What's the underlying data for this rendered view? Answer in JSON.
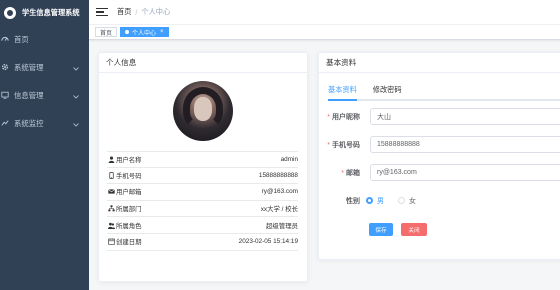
{
  "app": {
    "title": "学生信息管理系统"
  },
  "sidebar": {
    "items": [
      {
        "label": "首页",
        "icon": "dashboard-icon"
      },
      {
        "label": "系统管理",
        "icon": "gear-icon"
      },
      {
        "label": "信息管理",
        "icon": "monitor-icon"
      },
      {
        "label": "系统监控",
        "icon": "chart-icon"
      }
    ]
  },
  "navbar": {
    "breadcrumb": {
      "home": "首页",
      "separator": "/",
      "current": "个人中心"
    }
  },
  "tags": [
    {
      "label": "首页",
      "active": false
    },
    {
      "label": "个人中心",
      "active": true,
      "close": "×"
    }
  ],
  "profile_card": {
    "title": "个人信息",
    "rows": [
      {
        "label": "用户名称",
        "value": "admin",
        "icon": "user-icon"
      },
      {
        "label": "手机号码",
        "value": "15888888888",
        "icon": "phone-icon"
      },
      {
        "label": "用户邮箱",
        "value": "ry@163.com",
        "icon": "email-icon"
      },
      {
        "label": "所属部门",
        "value": "xx大学 / 校长",
        "icon": "tree-icon"
      },
      {
        "label": "所属角色",
        "value": "超级管理员",
        "icon": "people-icon"
      },
      {
        "label": "创建日期",
        "value": "2023-02-05 15:14:19",
        "icon": "date-icon"
      }
    ]
  },
  "basic_card": {
    "title": "基本资料",
    "tabs": {
      "basic": "基本资料",
      "password": "修改密码"
    },
    "form": {
      "nickname_label": "用户昵称",
      "nickname_value": "大山",
      "phone_label": "手机号码",
      "phone_value": "15888888888",
      "email_label": "邮箱",
      "email_value": "ry@163.com",
      "sex_label": "性别",
      "sex_male": "男",
      "sex_female": "女",
      "required_mark": "*"
    },
    "buttons": {
      "save": "保存",
      "close": "关闭"
    }
  },
  "colors": {
    "primary": "#409eff",
    "danger": "#f56c6c",
    "sidebar_bg": "#304156"
  }
}
